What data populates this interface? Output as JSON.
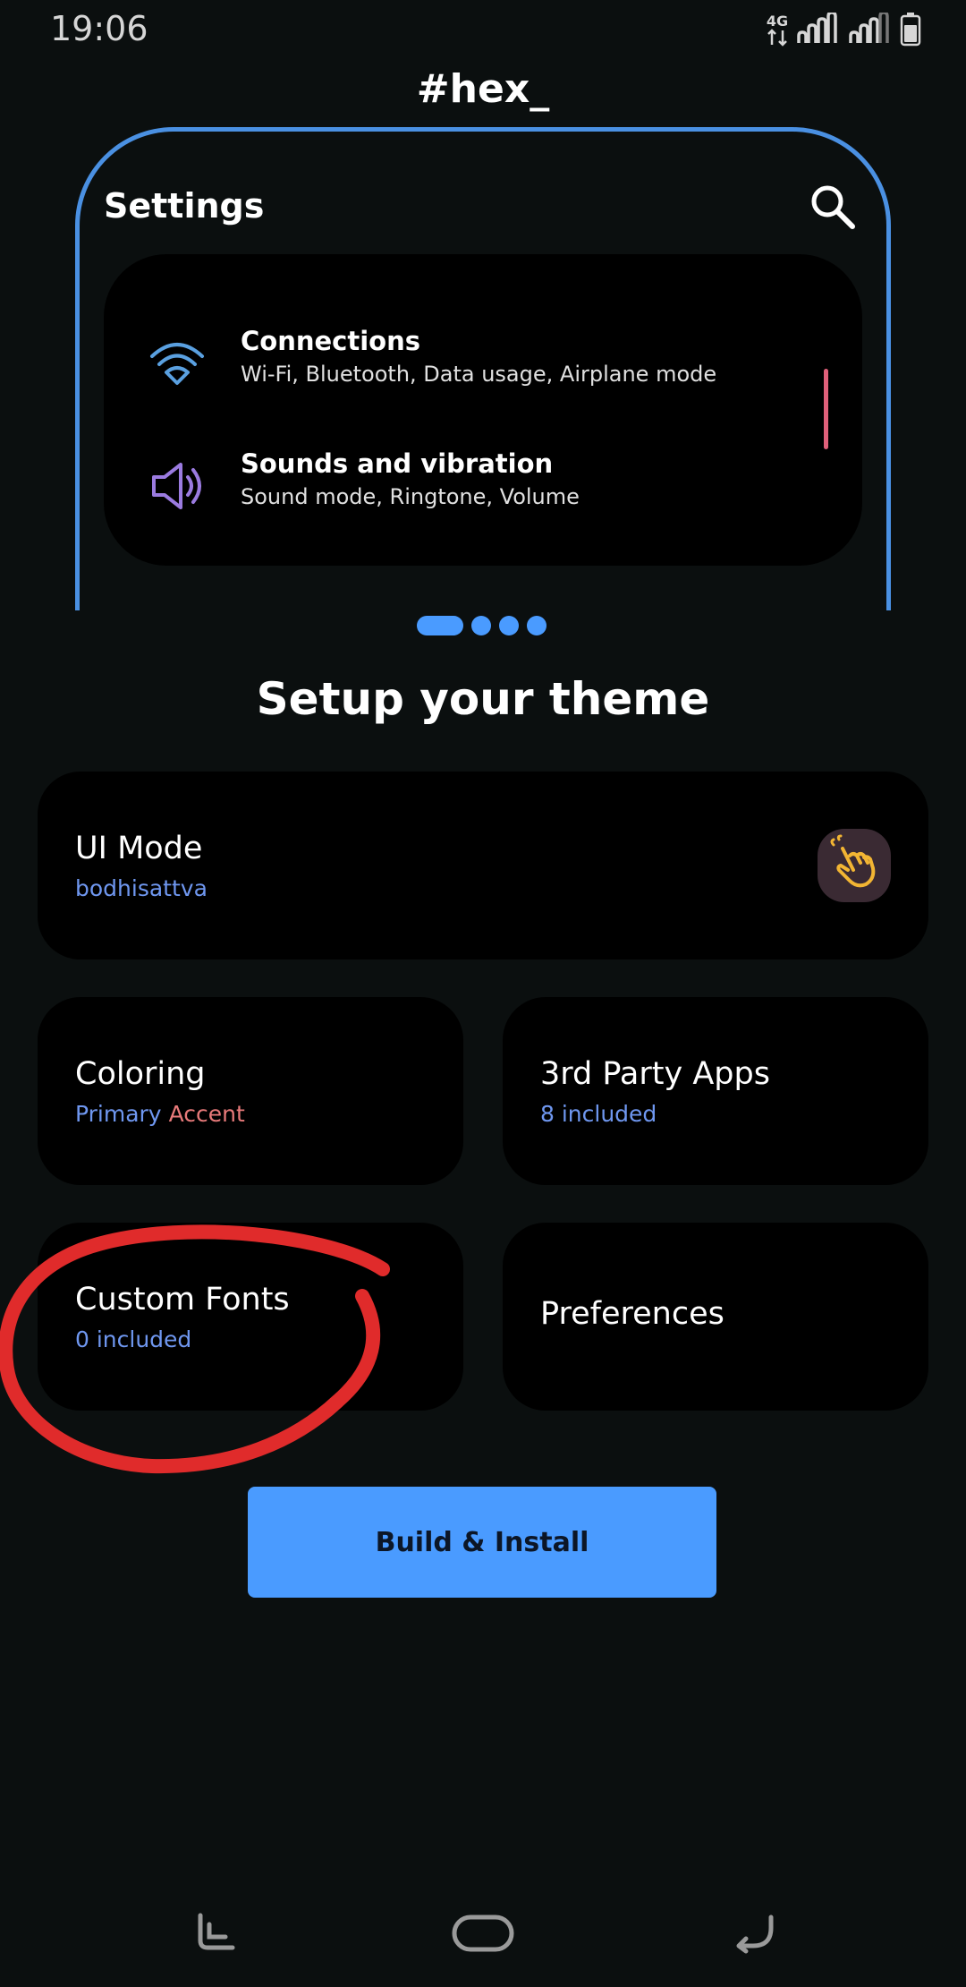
{
  "status_bar": {
    "time": "19:06",
    "network": "4G",
    "icons": [
      "network-4g-icon",
      "signal-icon",
      "signal-icon",
      "battery-icon"
    ]
  },
  "app": {
    "title": "#hex_"
  },
  "preview": {
    "title": "Settings",
    "search_icon": "search-icon",
    "items": [
      {
        "icon": "wifi-icon",
        "title": "Connections",
        "subtitle": "Wi-Fi, Bluetooth, Data usage, Airplane mode"
      },
      {
        "icon": "speaker-icon",
        "title": "Sounds and vibration",
        "subtitle": "Sound mode, Ringtone, Volume"
      }
    ],
    "pager": {
      "pages": 4,
      "active_index": 0
    }
  },
  "setup": {
    "heading": "Setup your theme",
    "ui_mode": {
      "title": "UI Mode",
      "value": "bodhisattva",
      "icon": "hand-pointer-icon"
    },
    "coloring": {
      "title": "Coloring",
      "value_part1": "Primary",
      "value_part2": "Accent"
    },
    "third_party": {
      "title": "3rd Party Apps",
      "value": "8 included"
    },
    "fonts": {
      "title": "Custom Fonts",
      "value": "0 included"
    },
    "preferences": {
      "title": "Preferences"
    }
  },
  "actions": {
    "build_label": "Build & Install"
  },
  "nav": {
    "recents": "recents-icon",
    "home": "home-icon",
    "back": "back-icon"
  },
  "colors": {
    "background": "#0b0f0f",
    "accent": "#4a9bff",
    "frame": "#4a90e2",
    "subtitle_blue": "#6f97f0",
    "accent_red": "#e87a7a",
    "annotation_red": "#e02b2b"
  }
}
